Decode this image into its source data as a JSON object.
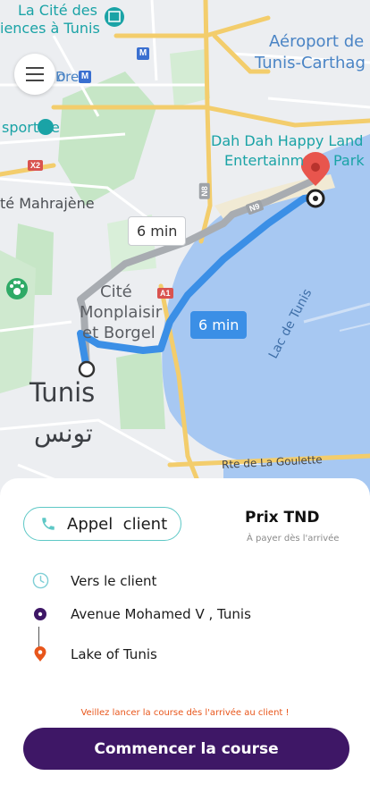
{
  "map": {
    "labels": {
      "cite_sciences": "La Cité des",
      "cite_sciences_2": "iences à Tunis",
      "airport": "Aéroport de",
      "airport_2": "Tunis-Carthag",
      "dah_dah": "Dah Dah Happy Land",
      "dah_dah_2": "Entertainm",
      "dah_dah_3": "Park",
      "sportive": "sportive",
      "mahrajene": "té Mahrajène",
      "cite": "Cité",
      "monplaisir": "Monplaisir",
      "borgel": "et Borgel",
      "tunis": "Tunis",
      "tunis_ar": "تونس",
      "lac": "Lac de Tunis",
      "goulette": "Rte de La Goulette",
      "store_partial": "D",
      "store_partial_2": "ore"
    },
    "shields": {
      "x2": "X2",
      "a1": "A1",
      "n8": "N8",
      "n9": "N9"
    },
    "metro_symbol": "M",
    "eta_alt": "6 min",
    "eta_main": "6 min",
    "colors": {
      "route_main": "#3b8fe6",
      "route_alt": "#a8acb1",
      "water": "#a7c8f2",
      "park": "#c6e6c6",
      "road_major": "#f7d683",
      "pin": "#e8554d"
    }
  },
  "sheet": {
    "call_button": "Appel  client",
    "price_title": "Prix TND",
    "price_subtitle": "À payer dès l'arrivée",
    "steps": [
      {
        "label": "Vers le client",
        "icon": "clock-icon"
      },
      {
        "label": "Avenue Mohamed V , Tunis",
        "icon": "origin-dot-icon"
      },
      {
        "label": "Lake of Tunis",
        "icon": "destination-pin-icon"
      }
    ],
    "warning": "Veillez lancer la course dès l'arrivée au client !",
    "start_button": "Commencer la course",
    "colors": {
      "accent_teal": "#5ec8c6",
      "primary_purple": "#3e1766",
      "warning_orange": "#e8561b"
    }
  }
}
